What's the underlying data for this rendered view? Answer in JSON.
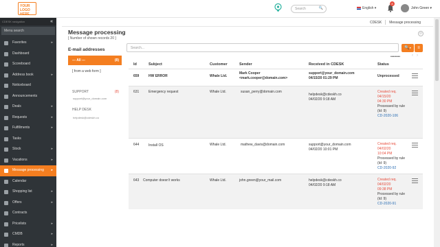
{
  "app": {
    "logo_text": "YOUR LOGO HERE",
    "search_placeholder": "Search",
    "language": "English",
    "notifications_count": "8",
    "user_name": "John Green"
  },
  "sidebar": {
    "header": "CDESK navigation",
    "search_placeholder": "Menu search",
    "items": [
      {
        "label": "Favorites",
        "has_arrow": true
      },
      {
        "label": "Dashboard",
        "has_arrow": false
      },
      {
        "label": "Scoreboard",
        "has_arrow": false
      },
      {
        "label": "Address book",
        "has_arrow": true
      },
      {
        "label": "Noticeboard",
        "has_arrow": false
      },
      {
        "label": "Announcements",
        "has_arrow": false
      },
      {
        "label": "Deals",
        "has_arrow": true
      },
      {
        "label": "Requests",
        "has_arrow": true
      },
      {
        "label": "Fulfillments",
        "has_arrow": true
      },
      {
        "label": "Tasks",
        "has_arrow": false
      },
      {
        "label": "Stock",
        "has_arrow": true
      },
      {
        "label": "Vacations",
        "has_arrow": true
      },
      {
        "label": "Message processing",
        "has_arrow": true,
        "active": true
      },
      {
        "label": "Calendar",
        "has_arrow": false
      },
      {
        "label": "Shopping list",
        "has_arrow": true
      },
      {
        "label": "Offers",
        "has_arrow": true
      },
      {
        "label": "Contracts",
        "has_arrow": false
      },
      {
        "label": "Pricelists",
        "has_arrow": true
      },
      {
        "label": "CMDB",
        "has_arrow": true
      },
      {
        "label": "Reports",
        "has_arrow": true
      }
    ]
  },
  "breadcrumbs": [
    "CDESK",
    "Message processing"
  ],
  "page": {
    "title": "Message processing",
    "subtitle": "[ Number of shown records 20 ]",
    "list_search_placeholder": "Search..."
  },
  "folders": {
    "heading": "E-mail addresses",
    "all_label": "--- All ---",
    "all_count": "(8)",
    "web_form_label": "[ from a web form ]",
    "support_label": "SUPPORT",
    "support_count": "(8)",
    "support_email": "support@your_domain.com",
    "helpdesk_label": "HELP DESK",
    "helpdesk_email": "helpdesk@cdeskh.co"
  },
  "table": {
    "headers": [
      "Id",
      "Subject",
      "Customer",
      "Sender",
      "Received in CDESK",
      "Status"
    ],
    "rows": [
      {
        "id": "659",
        "subject": "HW ERROR",
        "customer": "Whale Ltd.",
        "sender_name": "Mark Cooper",
        "sender_email": "<mark.cooper@domain.com>",
        "received_to": "support@your_domain.com",
        "received_at": "04/15/20 01:29 PM",
        "status": "Unprocessed",
        "bold": true
      },
      {
        "id": "631",
        "subject": "Emergency request",
        "customer": "Whale Ltd.",
        "sender_email": "susan_perry@domain.com",
        "received_to": "helpdesk@cdeskh.co",
        "received_at": "04/02/20 9:18 AM",
        "status_created": "Created req.",
        "status_date": "04/15/20",
        "status_time": "04:30 PM",
        "status_rule": "Processed by rule (Id: 9)",
        "status_ref": "CD-2020-106"
      },
      {
        "id": "644",
        "subject": "Install OS",
        "customer": "Whale Ltd.",
        "sender_email": "mathew_davis@domain.com",
        "received_to": "support@your_domain.com",
        "received_at": "04/02/20 10:01 PM",
        "status_created": "Created req.",
        "status_date": "04/02/20",
        "status_time": "10:04 PM",
        "status_rule": "Processed by rule (Id: 9)",
        "status_ref": "CD-2020-92"
      },
      {
        "id": "643",
        "subject": "Computer doesn't works",
        "customer": "Whale Ltd.",
        "sender_email": "john.green@your_mail.com",
        "received_to": "helpdesk@cdeskh.co",
        "received_at": "04/02/20 9:18 AM",
        "status_created": "Created req.",
        "status_date": "04/02/20",
        "status_time": "09:38 PM",
        "status_rule": "Processed by rule (Id: 9)",
        "status_ref": "CD-2020-91"
      }
    ]
  },
  "colors": {
    "accent": "#f47e20",
    "sidebar_bg": "#2f3438",
    "status_red": "#e74c3c",
    "link_blue": "#2a6db3"
  }
}
